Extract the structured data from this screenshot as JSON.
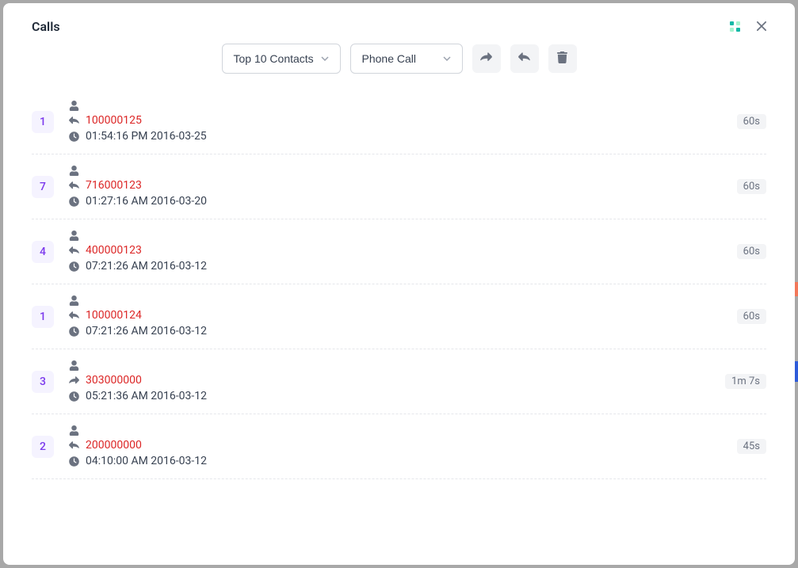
{
  "title": "Calls",
  "toolbar": {
    "contacts_filter": "Top 10 Contacts",
    "type_filter": "Phone Call"
  },
  "calls": [
    {
      "rank": "1",
      "number": "100000125",
      "direction": "reply",
      "timestamp": "01:54:16 PM 2016-03-25",
      "duration": "60s"
    },
    {
      "rank": "7",
      "number": "716000123",
      "direction": "reply",
      "timestamp": "01:27:16 AM 2016-03-20",
      "duration": "60s"
    },
    {
      "rank": "4",
      "number": "400000123",
      "direction": "reply",
      "timestamp": "07:21:26 AM 2016-03-12",
      "duration": "60s"
    },
    {
      "rank": "1",
      "number": "100000124",
      "direction": "reply",
      "timestamp": "07:21:26 AM 2016-03-12",
      "duration": "60s"
    },
    {
      "rank": "3",
      "number": "303000000",
      "direction": "share",
      "timestamp": "05:21:36 AM 2016-03-12",
      "duration": "1m 7s"
    },
    {
      "rank": "2",
      "number": "200000000",
      "direction": "reply",
      "timestamp": "04:10:00 AM 2016-03-12",
      "duration": "45s"
    }
  ]
}
